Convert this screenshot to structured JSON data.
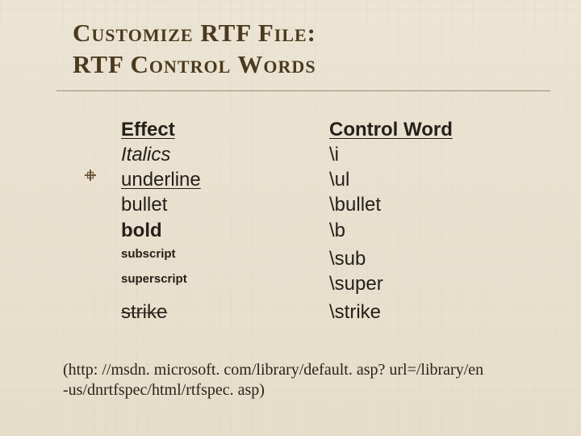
{
  "title": {
    "line1": "Customize RTF File:",
    "line2": "RTF Control Words"
  },
  "table": {
    "headers": {
      "effect": "Effect",
      "control_word": "Control Word"
    },
    "rows": [
      {
        "effect": "Italics",
        "effect_style": "italic",
        "cw": "\\i"
      },
      {
        "effect": "underline",
        "effect_style": "uline",
        "cw": "\\ul"
      },
      {
        "effect": "bullet",
        "effect_style": "",
        "cw": "\\bullet"
      },
      {
        "effect": "bold",
        "effect_style": "bold",
        "cw": "\\b"
      },
      {
        "effect": "subscript",
        "effect_style": "small",
        "cw": "\\sub"
      },
      {
        "effect": "superscript",
        "effect_style": "small",
        "cw": "\\super"
      },
      {
        "effect": "strike",
        "effect_style": "strike",
        "cw": "\\strike"
      }
    ]
  },
  "footnote": {
    "line1": "(http: //msdn. microsoft. com/library/default. asp? url=/library/en",
    "line2": " -us/dnrtfspec/html/rtfspec. asp)"
  }
}
